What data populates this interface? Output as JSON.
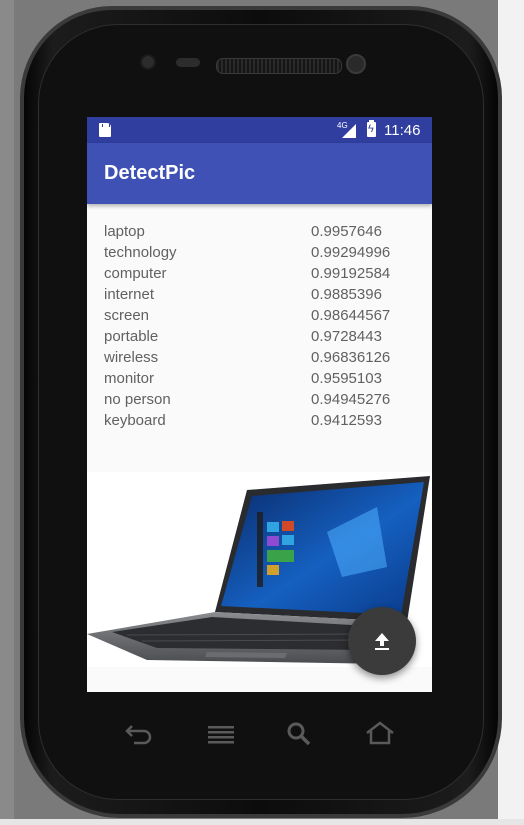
{
  "status_bar": {
    "network": "4G",
    "time": "11:46",
    "icons": [
      "sd-card-icon",
      "signal-icon",
      "battery-charging-icon"
    ]
  },
  "app": {
    "title": "DetectPic"
  },
  "results": [
    {
      "label": "laptop",
      "score": "0.9957646"
    },
    {
      "label": "technology",
      "score": "0.99294996"
    },
    {
      "label": "computer",
      "score": "0.99192584"
    },
    {
      "label": "internet",
      "score": "0.9885396"
    },
    {
      "label": "screen",
      "score": "0.98644567"
    },
    {
      "label": "portable",
      "score": "0.9728443"
    },
    {
      "label": "wireless",
      "score": "0.96836126"
    },
    {
      "label": "monitor",
      "score": "0.9595103"
    },
    {
      "label": "no person",
      "score": "0.94945276"
    },
    {
      "label": "keyboard",
      "score": "0.9412593"
    }
  ],
  "fab": {
    "icon": "upload-icon"
  },
  "nav_bar": {
    "icons": [
      "back-icon",
      "menu-icon",
      "search-icon",
      "home-icon"
    ]
  },
  "colors": {
    "status_bar": "#303f9f",
    "app_bar": "#3f51b5",
    "fab": "#3b3b3b",
    "text": "#616161"
  }
}
